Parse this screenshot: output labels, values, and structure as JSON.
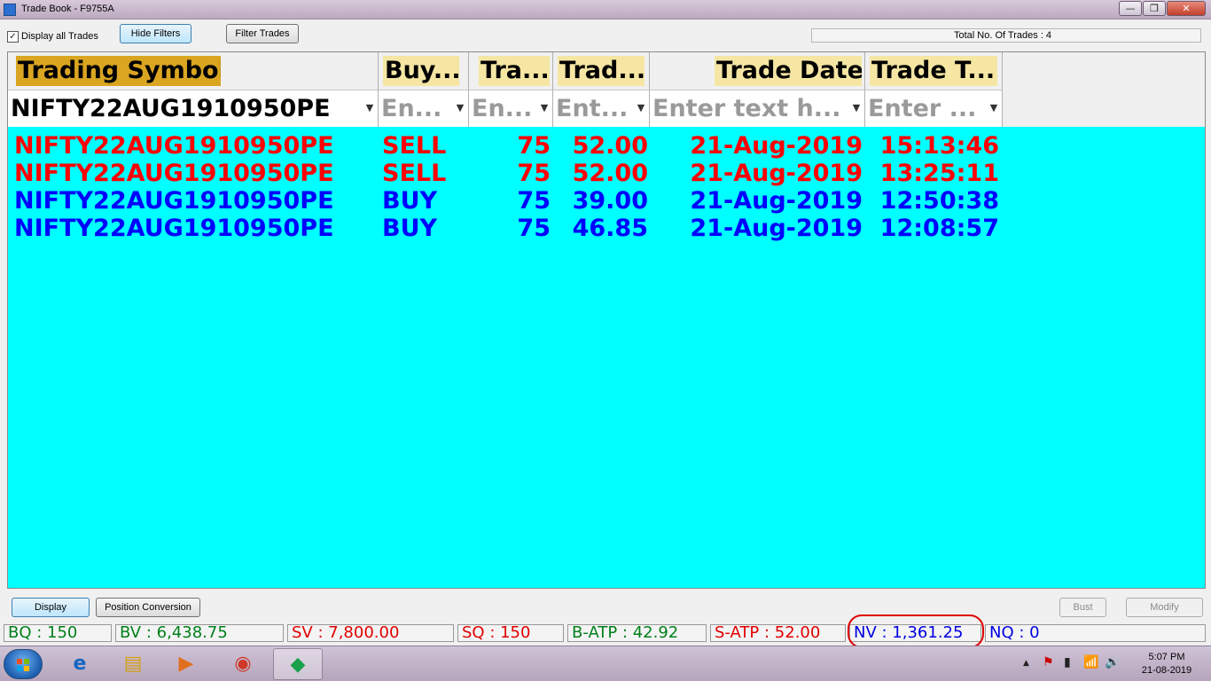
{
  "window": {
    "title": "Trade Book - F9755A",
    "minimize": "—",
    "maximize": "❐",
    "close": "✕"
  },
  "toolbar": {
    "display_all_checked": "✓",
    "display_all_label": "Display all Trades",
    "hide_filters": "Hide Filters",
    "filter_trades": "Filter Trades",
    "total_trades": "Total No. Of Trades : 4"
  },
  "grid": {
    "columns": [
      "Trading Symbol",
      "Buy...",
      "Tra...",
      "Trad...",
      "Trade Date",
      "Trade T..."
    ],
    "filters": [
      "NIFTY22AUG1910950PE",
      "En...",
      "En...",
      "Ent...",
      "Enter text h...",
      "Enter ..."
    ],
    "filter_icon": "▼",
    "rows": [
      {
        "symbol": "NIFTY22AUG1910950PE",
        "side": "SELL",
        "qty": "75",
        "price": "52.00",
        "date": "21-Aug-2019",
        "time": "15:13:46"
      },
      {
        "symbol": "NIFTY22AUG1910950PE",
        "side": "SELL",
        "qty": "75",
        "price": "52.00",
        "date": "21-Aug-2019",
        "time": "13:25:11"
      },
      {
        "symbol": "NIFTY22AUG1910950PE",
        "side": "BUY",
        "qty": "75",
        "price": "39.00",
        "date": "21-Aug-2019",
        "time": "12:50:38"
      },
      {
        "symbol": "NIFTY22AUG1910950PE",
        "side": "BUY",
        "qty": "75",
        "price": "46.85",
        "date": "21-Aug-2019",
        "time": "12:08:57"
      }
    ]
  },
  "buttons": {
    "display": "Display",
    "position_conversion": "Position Conversion",
    "bust": "Bust",
    "modify": "Modify"
  },
  "status": {
    "bq": "BQ : 150",
    "bv": "BV : 6,438.75",
    "sv": "SV : 7,800.00",
    "sq": "SQ : 150",
    "batp": "B-ATP : 42.92",
    "satp": "S-ATP : 52.00",
    "nv": "NV : 1,361.25",
    "nq": "NQ : 0"
  },
  "taskbar": {
    "items": [
      "e",
      "▤",
      "▶",
      "◉",
      "◆"
    ],
    "tray": [
      "▲",
      "⚑",
      "▮",
      "📶",
      "🔊"
    ],
    "time": "5:07 PM",
    "date": "21-08-2019"
  },
  "colors": {
    "grid_bg": "#00ffff",
    "sell": "#ff0000",
    "buy": "#0000ff",
    "header_symbol": "#daa520",
    "header_other": "#f5e6a3"
  }
}
